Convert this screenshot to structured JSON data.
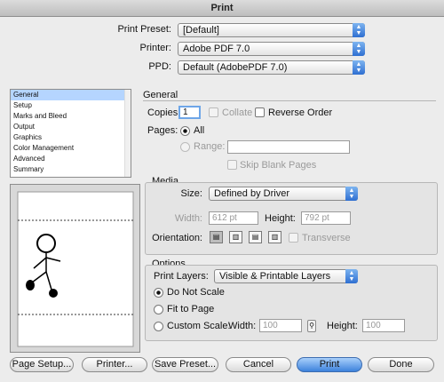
{
  "window": {
    "title": "Print"
  },
  "top": {
    "preset_label": "Print Preset:",
    "preset_value": "[Default]",
    "printer_label": "Printer:",
    "printer_value": "Adobe PDF 7.0",
    "ppd_label": "PPD:",
    "ppd_value": "Default (AdobePDF 7.0)"
  },
  "sidebar": {
    "items": [
      {
        "label": "General"
      },
      {
        "label": "Setup"
      },
      {
        "label": "Marks and Bleed"
      },
      {
        "label": "Output"
      },
      {
        "label": "Graphics"
      },
      {
        "label": "Color Management"
      },
      {
        "label": "Advanced"
      },
      {
        "label": "Summary"
      }
    ],
    "selected": "General"
  },
  "general": {
    "title": "General",
    "copies_label": "Copies:",
    "copies_value": "1",
    "collate_label": "Collate",
    "reverse_label": "Reverse Order",
    "pages_label": "Pages:",
    "all_label": "All",
    "range_label": "Range:",
    "skip_label": "Skip Blank Pages"
  },
  "media": {
    "title": "Media",
    "size_label": "Size:",
    "size_value": "Defined by Driver",
    "width_label": "Width:",
    "width_value": "612 pt",
    "height_label": "Height:",
    "height_value": "792 pt",
    "orientation_label": "Orientation:",
    "transverse_label": "Transverse"
  },
  "options": {
    "title": "Options",
    "layers_label": "Print Layers:",
    "layers_value": "Visible & Printable Layers",
    "no_scale_label": "Do Not Scale",
    "fit_label": "Fit to Page",
    "custom_label": "Custom Scale:",
    "cwidth_label": "Width:",
    "cwidth_value": "100",
    "cheight_label": "Height:",
    "cheight_value": "100"
  },
  "buttons": {
    "page_setup": "Page Setup...",
    "printer": "Printer...",
    "save_preset": "Save Preset...",
    "cancel": "Cancel",
    "print": "Print",
    "done": "Done"
  }
}
